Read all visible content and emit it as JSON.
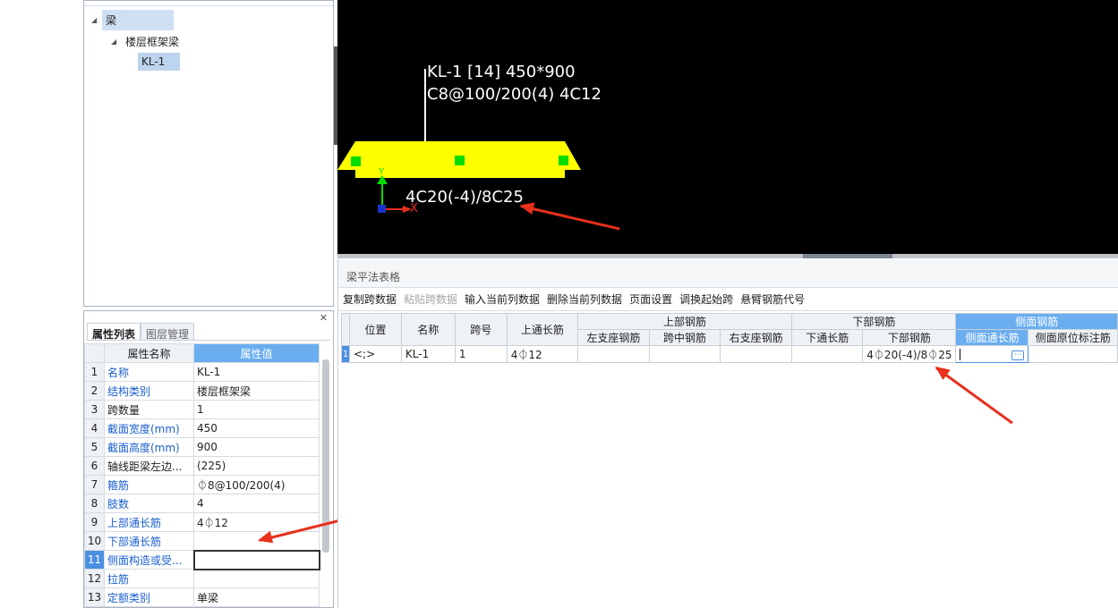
{
  "tree": {
    "nodes": [
      {
        "label": "梁",
        "expanded": true
      },
      {
        "label": "楼层框架梁",
        "expanded": true
      },
      {
        "label": "KL-1",
        "selected": true
      }
    ]
  },
  "properties": {
    "tabs": [
      "属性列表",
      "图层管理"
    ],
    "header": {
      "name": "属性名称",
      "value": "属性值"
    },
    "rows": [
      {
        "idx": "1",
        "name": "名称",
        "value": "KL-1",
        "blue": true
      },
      {
        "idx": "2",
        "name": "结构类别",
        "value": "楼层框架梁",
        "blue": true
      },
      {
        "idx": "3",
        "name": "跨数量",
        "value": "1",
        "blue": false
      },
      {
        "idx": "4",
        "name": "截面宽度(mm)",
        "value": "450",
        "blue": true
      },
      {
        "idx": "5",
        "name": "截面高度(mm)",
        "value": "900",
        "blue": true
      },
      {
        "idx": "6",
        "name": "轴线距梁左边...",
        "value": "(225)",
        "blue": false
      },
      {
        "idx": "7",
        "name": "箍筋",
        "value": "⏀8@100/200(4)",
        "blue": true
      },
      {
        "idx": "8",
        "name": "肢数",
        "value": "4",
        "blue": true
      },
      {
        "idx": "9",
        "name": "上部通长筋",
        "value": "4⏀12",
        "blue": true
      },
      {
        "idx": "10",
        "name": "下部通长筋",
        "value": "",
        "blue": true
      },
      {
        "idx": "11",
        "name": "侧面构造或受...",
        "value": "",
        "blue": true,
        "selected": true
      },
      {
        "idx": "12",
        "name": "拉筋",
        "value": "",
        "blue": true
      },
      {
        "idx": "13",
        "name": "定额类别",
        "value": "单梁",
        "blue": true
      }
    ]
  },
  "canvas": {
    "beam_label_line1": "KL-1 [14] 450*900",
    "beam_label_line2": "C8@100/200(4) 4C12",
    "bottom_label": "4C20(-4)/8C25",
    "axis_x": "X",
    "axis_y": "Y",
    "colors": {
      "background": "#000000",
      "beam": "#ffff00",
      "node": "#00dd00",
      "arrow": "#e8301c"
    }
  },
  "grid": {
    "title": "梁平法表格",
    "toolbar": [
      {
        "label": "复制跨数据",
        "disabled": false
      },
      {
        "label": "粘贴跨数据",
        "disabled": true
      },
      {
        "label": "输入当前列数据",
        "disabled": false
      },
      {
        "label": "删除当前列数据",
        "disabled": false
      },
      {
        "label": "页面设置",
        "disabled": false
      },
      {
        "label": "调换起始跨",
        "disabled": false
      },
      {
        "label": "悬臂钢筋代号",
        "disabled": false
      }
    ],
    "headers": {
      "position": "位置",
      "name": "名称",
      "span": "跨号",
      "top_through": "上通长筋",
      "top_group": "上部钢筋",
      "left_support": "左支座钢筋",
      "mid_span": "跨中钢筋",
      "right_support": "右支座钢筋",
      "bottom_group": "下部钢筋",
      "bottom_through": "下通长筋",
      "bottom_bars": "下部钢筋",
      "side_group": "侧面钢筋",
      "side_through": "侧面通长筋",
      "side_original": "侧面原位标注筋"
    },
    "row": {
      "idx": "1",
      "position": "<;>",
      "name": "KL-1",
      "span": "1",
      "top_through": "4⏀12",
      "left_support": "",
      "mid_span": "",
      "right_support": "",
      "bottom_through": "",
      "bottom_bars": "4⏀20(-4)/8⏀25",
      "side_through": "",
      "side_original": "",
      "ellipsis": "···"
    }
  }
}
